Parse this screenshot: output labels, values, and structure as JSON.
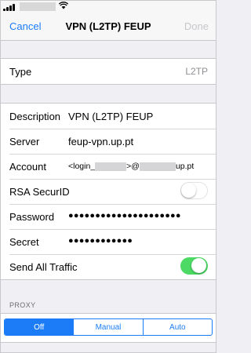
{
  "nav": {
    "cancel_label": "Cancel",
    "title": "VPN (L2TP) FEUP",
    "done_label": "Done"
  },
  "type_row": {
    "label": "Type",
    "value": "L2TP"
  },
  "details": {
    "description": {
      "label": "Description",
      "value": "VPN (L2TP) FEUP"
    },
    "server": {
      "label": "Server",
      "value": "feup-vpn.up.pt"
    },
    "account": {
      "label": "Account",
      "prefix": "<login_",
      "middle": ">@",
      "suffix": "up.pt"
    },
    "rsa": {
      "label": "RSA SecurID",
      "enabled": false
    },
    "password": {
      "label": "Password",
      "value": "●●●●●●●●●●●●●●●●●●●●●"
    },
    "secret": {
      "label": "Secret",
      "value": "●●●●●●●●●●●●"
    },
    "send_all": {
      "label": "Send All Traffic",
      "enabled": true
    }
  },
  "proxy": {
    "header": "PROXY",
    "options": [
      "Off",
      "Manual",
      "Auto"
    ],
    "selected": "Off"
  },
  "colors": {
    "accent": "#1c7cf7",
    "toggle_on": "#4cd964",
    "disabled": "#c7c7cc"
  }
}
